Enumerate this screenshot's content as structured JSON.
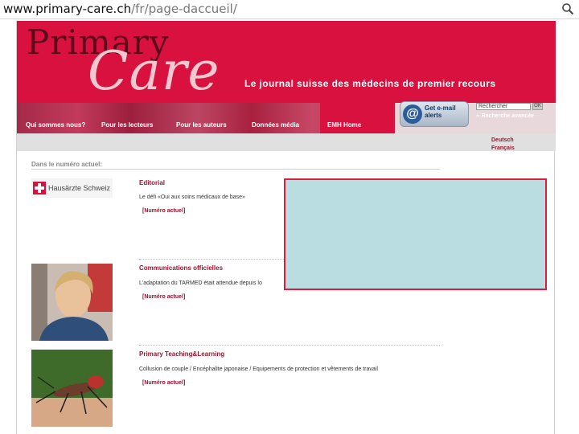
{
  "browser": {
    "url_host": "www.primary-care.ch",
    "url_path": "/fr/page-daccueil/",
    "zoom_icon": "magnifier-icon"
  },
  "header": {
    "logo_word1": "Primary",
    "logo_word2": "Care",
    "tagline": "Le journal suisse des médecins de premier recours"
  },
  "nav": {
    "items": [
      "Qui sommes nous?",
      "Pour les lecteurs",
      "Pour les auteurs",
      "Données média",
      "EMH Home"
    ],
    "email_alert": "Get e-mail alerts",
    "search_placeholder": "Rechercher",
    "search_button": "OK",
    "advanced_search": "›› Recherche avancée"
  },
  "languages": [
    "Deutsch",
    "Français"
  ],
  "content": {
    "section_title": "Dans le numéro actuel:",
    "image_caption": "Hausärzte Schweiz",
    "articles": [
      {
        "category": "Editorial",
        "text": "Le défi «Oui aux soins médicaux de base»",
        "link": "[Numéro actuel]"
      },
      {
        "category": "Communications officielles",
        "text": "L'adaptation du TARMED était attendue depuis lo",
        "link": "[Numéro actuel]"
      },
      {
        "category": "Primary Teaching&Learning",
        "text": "Collusion de couple / Encéphalite japonaise / Equipements de protection et vêtements de travail",
        "link": "[Numéro actuel]"
      }
    ]
  },
  "colors": {
    "brand": "#d9113e",
    "brand_dark": "#a0102e",
    "overlay_fill": "#badde2",
    "overlay_border": "#e01b3a"
  }
}
